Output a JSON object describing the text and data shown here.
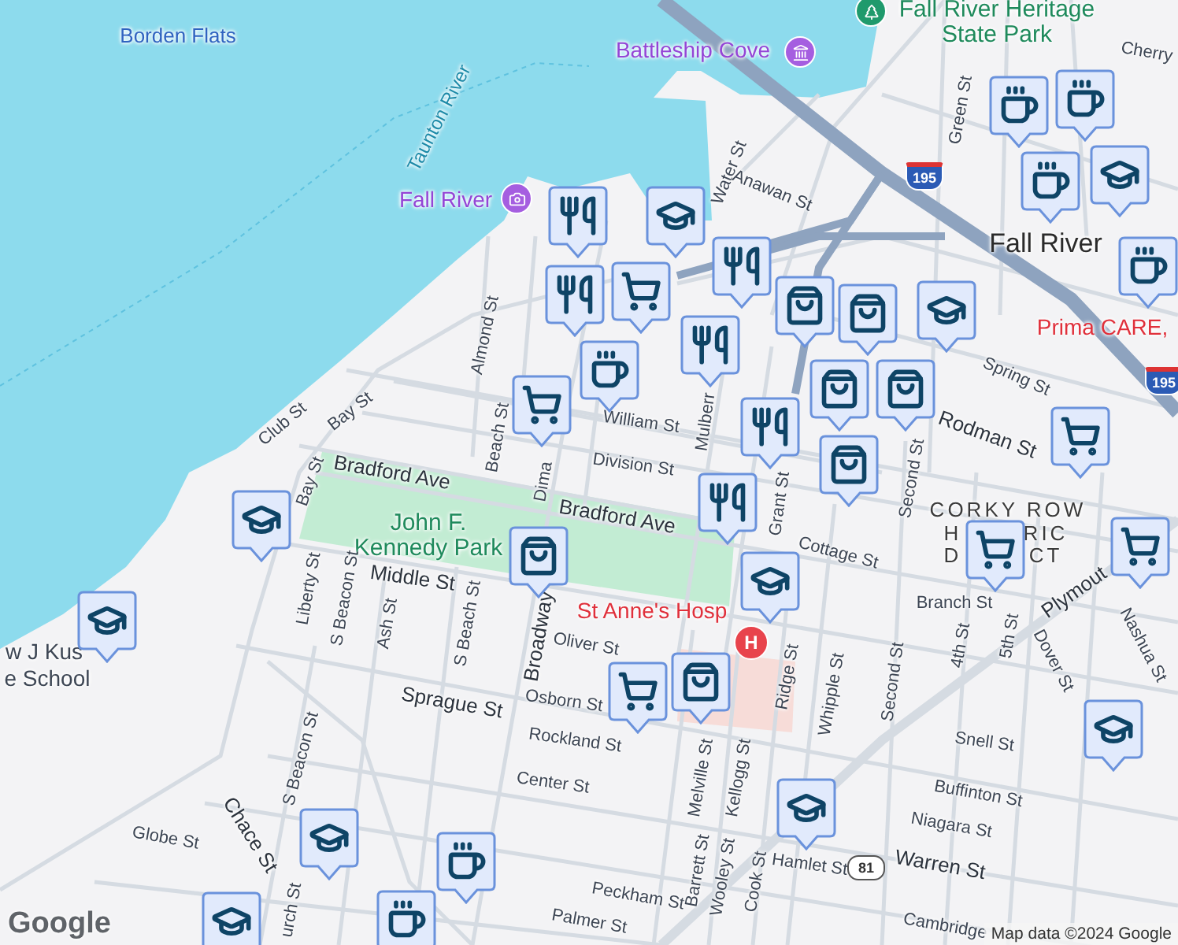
{
  "labels": [
    {
      "text": "Borden Flats",
      "kind": "water"
    },
    {
      "text": "Taunton River",
      "kind": "river"
    },
    {
      "text": "Fall River",
      "kind": "attraction"
    },
    {
      "text": "Battleship Cove",
      "kind": "attraction"
    },
    {
      "text": "Fall River Heritage State Park",
      "kind": "park"
    },
    {
      "text": "Cherry",
      "kind": "street"
    },
    {
      "text": "Green St",
      "kind": "street"
    },
    {
      "text": "Water St",
      "kind": "street"
    },
    {
      "text": "Anawan St",
      "kind": "street"
    },
    {
      "text": "Fall River",
      "kind": "city"
    },
    {
      "text": "Prima CARE,",
      "kind": "clinic"
    },
    {
      "text": "Spring St",
      "kind": "street"
    },
    {
      "text": "Rodman St",
      "kind": "major"
    },
    {
      "text": "Almond St",
      "kind": "street"
    },
    {
      "text": "Club St",
      "kind": "street"
    },
    {
      "text": "Bay St",
      "kind": "street"
    },
    {
      "text": "Beach St",
      "kind": "street"
    },
    {
      "text": "Dima",
      "kind": "street"
    },
    {
      "text": "William St",
      "kind": "street"
    },
    {
      "text": "Division St",
      "kind": "street"
    },
    {
      "text": "Mulberr",
      "kind": "street"
    },
    {
      "text": "Grant St",
      "kind": "street"
    },
    {
      "text": "Bradford Ave",
      "kind": "major"
    },
    {
      "text": "Bradford Ave",
      "kind": "major"
    },
    {
      "text": "Bay St",
      "kind": "street"
    },
    {
      "text": "John F. Kennedy Park",
      "kind": "park"
    },
    {
      "text": "Middle St",
      "kind": "major"
    },
    {
      "text": "Liberty St",
      "kind": "street"
    },
    {
      "text": "S Beacon St",
      "kind": "street"
    },
    {
      "text": "Ash St",
      "kind": "street"
    },
    {
      "text": "S Beach St",
      "kind": "street"
    },
    {
      "text": "Broadway",
      "kind": "major"
    },
    {
      "text": "Oliver St",
      "kind": "street"
    },
    {
      "text": "Sprague St",
      "kind": "major"
    },
    {
      "text": "Osborn St",
      "kind": "street"
    },
    {
      "text": "Rockland St",
      "kind": "street"
    },
    {
      "text": "Center St",
      "kind": "street"
    },
    {
      "text": "S Beacon St",
      "kind": "street"
    },
    {
      "text": "Chace St",
      "kind": "major"
    },
    {
      "text": "Globe St",
      "kind": "street"
    },
    {
      "text": "urch St",
      "kind": "street"
    },
    {
      "text": "Palmer St",
      "kind": "street"
    },
    {
      "text": "Peckham St",
      "kind": "street"
    },
    {
      "text": "St Anne's Hosp",
      "kind": "hospital"
    },
    {
      "text": "Cottage St",
      "kind": "street"
    },
    {
      "text": "CORKY ROW",
      "kind": "district"
    },
    {
      "text": "H",
      "kind": "district"
    },
    {
      "text": "RIC",
      "kind": "district"
    },
    {
      "text": "D",
      "kind": "district"
    },
    {
      "text": "CT",
      "kind": "district"
    },
    {
      "text": "Branch St",
      "kind": "street"
    },
    {
      "text": "4th St",
      "kind": "street"
    },
    {
      "text": "5th St",
      "kind": "street"
    },
    {
      "text": "Second St",
      "kind": "street"
    },
    {
      "text": "Second St",
      "kind": "street"
    },
    {
      "text": "Plymout",
      "kind": "major"
    },
    {
      "text": "Nashua St",
      "kind": "street"
    },
    {
      "text": "Dover St",
      "kind": "street"
    },
    {
      "text": "Ridge St",
      "kind": "street"
    },
    {
      "text": "Whipple St",
      "kind": "street"
    },
    {
      "text": "Melville St",
      "kind": "street"
    },
    {
      "text": "Kellogg St",
      "kind": "street"
    },
    {
      "text": "Barrett St",
      "kind": "street"
    },
    {
      "text": "Wooley St",
      "kind": "street"
    },
    {
      "text": "Cook St",
      "kind": "street"
    },
    {
      "text": "Hamlet St",
      "kind": "street"
    },
    {
      "text": "Snell St",
      "kind": "street"
    },
    {
      "text": "Buffinton St",
      "kind": "street"
    },
    {
      "text": "Niagara St",
      "kind": "street"
    },
    {
      "text": "Warren St",
      "kind": "major"
    },
    {
      "text": "Cambridge",
      "kind": "street"
    },
    {
      "text": "w J Kus",
      "kind": "school"
    },
    {
      "text": "e School",
      "kind": "school"
    }
  ],
  "hospital_badge": "H",
  "shields": [
    "195",
    "195",
    "81"
  ],
  "markers": [
    {
      "kind": "restaurant"
    },
    {
      "kind": "school"
    },
    {
      "kind": "grocery"
    },
    {
      "kind": "restaurant"
    },
    {
      "kind": "coffee"
    },
    {
      "kind": "restaurant"
    },
    {
      "kind": "shopping"
    },
    {
      "kind": "restaurant"
    },
    {
      "kind": "shopping"
    },
    {
      "kind": "shopping"
    },
    {
      "kind": "shopping"
    },
    {
      "kind": "school"
    },
    {
      "kind": "grocery"
    },
    {
      "kind": "shopping"
    },
    {
      "kind": "restaurant"
    },
    {
      "kind": "restaurant"
    },
    {
      "kind": "coffee"
    },
    {
      "kind": "coffee"
    },
    {
      "kind": "coffee"
    },
    {
      "kind": "school"
    },
    {
      "kind": "coffee"
    },
    {
      "kind": "grocery"
    },
    {
      "kind": "school"
    },
    {
      "kind": "shopping"
    },
    {
      "kind": "school"
    },
    {
      "kind": "grocery"
    },
    {
      "kind": "grocery"
    },
    {
      "kind": "shopping"
    },
    {
      "kind": "grocery"
    },
    {
      "kind": "school"
    },
    {
      "kind": "school"
    },
    {
      "kind": "school"
    },
    {
      "kind": "school"
    },
    {
      "kind": "coffee"
    },
    {
      "kind": "school"
    },
    {
      "kind": "coffee"
    }
  ],
  "logo": "Google",
  "attribution": "Map data ©2024 Google"
}
